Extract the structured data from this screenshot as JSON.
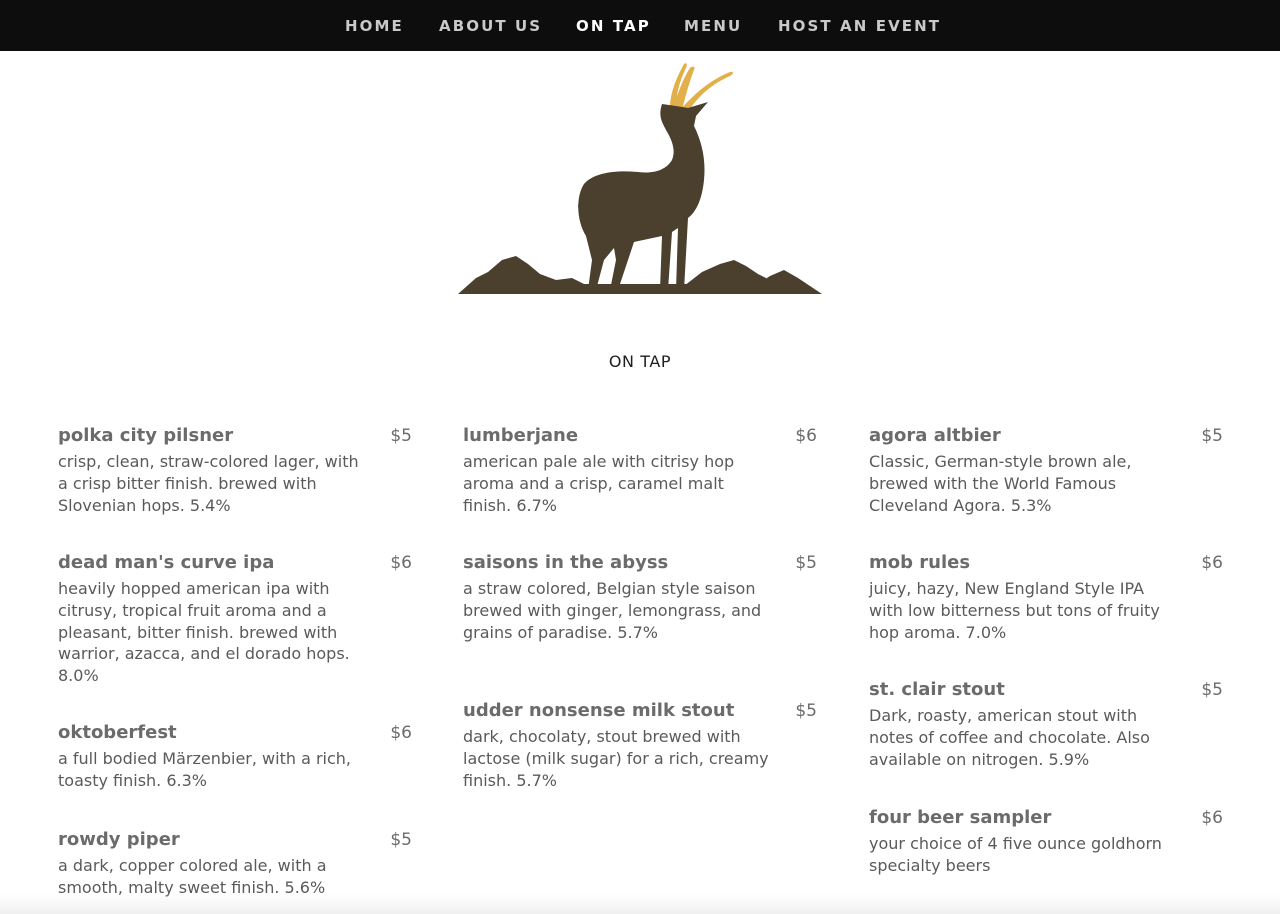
{
  "nav": {
    "home": "HOME",
    "about": "ABOUT US",
    "on_tap": "ON TAP",
    "menu": "MENU",
    "host_event": "HOST AN EVENT"
  },
  "page_title": "ON TAP",
  "colors": {
    "nav_background": "#0d0d0d",
    "logo_body": "#4b3f2e",
    "logo_horns": "#e2b04a"
  },
  "beers": [
    {
      "name": "polka city pilsner",
      "price": "$5",
      "desc": "crisp, clean, straw-colored lager, with a crisp bitter finish. brewed with Slovenian hops. 5.4%"
    },
    {
      "name": "dead man's curve ipa",
      "price": "$6",
      "desc": "heavily hopped american ipa with citrusy, tropical fruit aroma and a pleasant, bitter finish. brewed with warrior, azacca, and el dorado hops. 8.0%"
    },
    {
      "name": "oktoberfest",
      "price": "$6",
      "desc": "a full bodied Märzenbier, with a rich, toasty finish. 6.3%"
    },
    {
      "name": "rowdy piper",
      "price": "$5",
      "desc": "a dark, copper colored ale, with a smooth, malty sweet finish. 5.6%"
    },
    {
      "name": "lumberjane",
      "price": "$6",
      "desc": "american pale ale with citrisy hop aroma and a crisp, caramel malt finish. 6.7%"
    },
    {
      "name": "saisons in the abyss",
      "price": "$5",
      "desc": "a straw colored, Belgian style saison brewed with ginger, lemongrass, and grains of paradise. 5.7%"
    },
    {
      "name": "udder nonsense milk stout",
      "price": "$5",
      "desc": "dark, chocolaty, stout brewed with lactose (milk sugar) for a rich, creamy finish. 5.7%"
    },
    {
      "name": "agora altbier",
      "price": "$5",
      "desc": "Classic, German-style brown ale, brewed with the World Famous Cleveland Agora. 5.3%"
    },
    {
      "name": "mob rules",
      "price": "$6",
      "desc": "juicy, hazy, New England Style IPA with low bitterness but tons of fruity hop aroma. 7.0%"
    },
    {
      "name": "st. clair stout",
      "price": "$5",
      "desc": "Dark, roasty, american stout with notes of coffee and chocolate. Also available on nitrogen. 5.9%"
    },
    {
      "name": "four beer sampler",
      "price": "$6",
      "desc": "your choice of 4 five ounce goldhorn specialty beers"
    }
  ]
}
